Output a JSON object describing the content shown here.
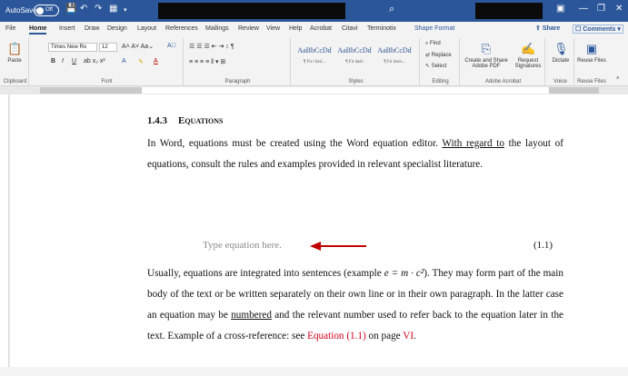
{
  "titlebar": {
    "autosave": "AutoSave",
    "toggle": "Off"
  },
  "tabs": [
    "File",
    "Home",
    "Insert",
    "Draw",
    "Design",
    "Layout",
    "References",
    "Mailings",
    "Review",
    "View",
    "Help",
    "Acrobat",
    "Citavi",
    "Terminotix",
    "Shape Format"
  ],
  "share": "Share",
  "comments": "Comments",
  "ribbon": {
    "paste": "Paste",
    "clipboard": "Clipboard",
    "font_name": "Times New Ro",
    "font_size": "12",
    "font_group": "Font",
    "paragraph_group": "Paragraph",
    "style_preview": "AaBbCcDd",
    "styles": [
      "¶ Fit citati...",
      "¶ Fit dash",
      "¶ Fit dash..."
    ],
    "styles_group": "Styles",
    "find": "Find",
    "replace": "Replace",
    "select": "Select",
    "editing_group": "Editing",
    "create_share": "Create and Share Adobe PDF",
    "request_sig": "Request Signatures",
    "acrobat_group": "Adobe Acrobat",
    "dictate": "Dictate",
    "voice_group": "Voice",
    "reuse": "Reuse Files",
    "reuse_group": "Reuse Files"
  },
  "document": {
    "heading_number": "1.4.3",
    "heading_title": "Equations",
    "p1_a": "In Word, equations must be created using the Word equation editor. ",
    "p1_link": "With regard to",
    "p1_b": " the layout of equations, consult the rules and examples provided in relevant specialist literature.",
    "eq_placeholder": "Type equation here.",
    "eq_number": "(1.1)",
    "p2_a": "Usually, equations are integrated into sentences (example ",
    "p2_math": "e = m · c²",
    "p2_b": "). They may form part of the main body of the text or be written separately on their own line or in their own paragraph. In the latter case an equation may be ",
    "p2_link": "numbered",
    "p2_c": " and the relevant number used to refer back to the equation later in the text. Example of a cross-reference: see ",
    "p2_ref1": "Equation (1.1)",
    "p2_d": " on page ",
    "p2_ref2": "VI",
    "p2_e": "."
  },
  "colors": {
    "accent": "#2b579a",
    "reference": "#d0021b",
    "arrow": "#c00000"
  }
}
